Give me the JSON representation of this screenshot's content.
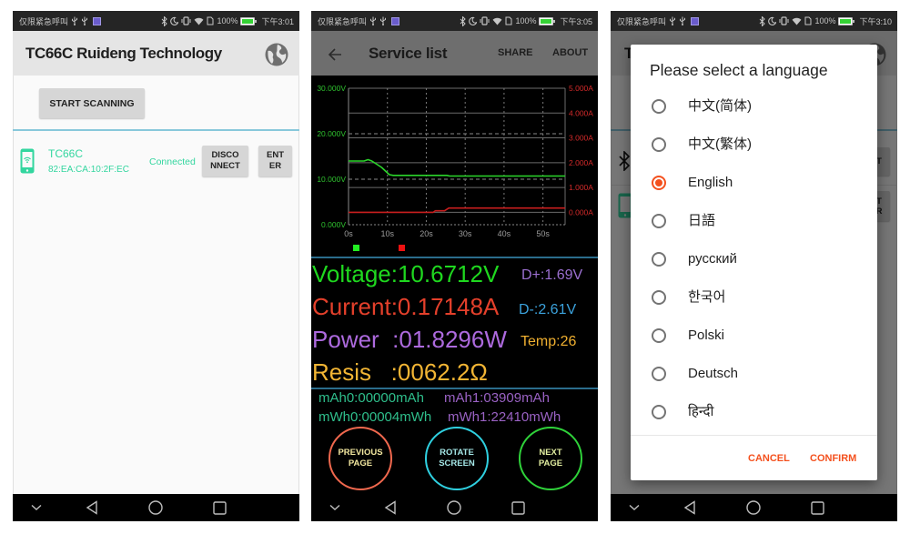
{
  "status_bar": {
    "carrier_text": "仅限紧急呼叫",
    "battery_percent": "100%",
    "icons": [
      "usb-icon",
      "usb-icon",
      "app-notification-icon",
      "bluetooth-icon",
      "moon-icon",
      "vibrate-icon",
      "wifi-icon",
      "sim-icon",
      "battery-icon"
    ]
  },
  "screens": [
    {
      "status_time": "下午3:01"
    },
    {
      "status_time": "下午3:05"
    },
    {
      "status_time": "下午3:10"
    }
  ],
  "navigation": {
    "icons": [
      "chevron-down-icon",
      "back-icon",
      "home-icon",
      "recents-icon"
    ]
  },
  "scan_screen": {
    "title": "TC66C Ruideng Technology",
    "language_icon": "globe-icon",
    "start_scanning_label": "START SCANNING",
    "device": {
      "icon": "phone-wifi-icon",
      "name": "TC66C",
      "mac": "82:EA:CA:10:2F:EC",
      "status": "Connected",
      "disconnect_label": "DISCO\nNNECT",
      "enter_label": "ENT\nER"
    }
  },
  "service_screen": {
    "title": "Service list",
    "share_label": "SHARE",
    "about_label": "ABOUT",
    "readings": {
      "voltage": "Voltage:10.6712V",
      "current": "Current:0.17148A",
      "power": "Power  :01.8296W",
      "resistance": "Resis   :0062.2Ω"
    },
    "side_readings": {
      "d_plus": "D+:1.69V",
      "d_minus": "D-:2.61V",
      "temperature": "Temp:26"
    },
    "accumulators": {
      "mah0": "mAh0:00000mAh",
      "mah1": "mAh1:03909mAh",
      "mwh0": "mWh0:00004mWh",
      "mwh1": "mWh1:22410mWh"
    },
    "buttons": {
      "previous": "PREVIOUS\nPAGE",
      "rotate": "ROTATE\nSCREEN",
      "next": "NEXT\nPAGE"
    }
  },
  "language_screen": {
    "background": {
      "title_fragment": "T",
      "button1_fragment": "T",
      "button2_fragment": "T\nR"
    },
    "dialog": {
      "title": "Please select a language",
      "options": [
        {
          "label": "中文(简体)",
          "selected": false
        },
        {
          "label": "中文(繁体)",
          "selected": false
        },
        {
          "label": "English",
          "selected": true
        },
        {
          "label": "日語",
          "selected": false
        },
        {
          "label": "русский",
          "selected": false
        },
        {
          "label": "한국어",
          "selected": false
        },
        {
          "label": "Polski",
          "selected": false
        },
        {
          "label": "Deutsch",
          "selected": false
        },
        {
          "label": "हिन्दी",
          "selected": false
        }
      ],
      "cancel_label": "CANCEL",
      "confirm_label": "CONFIRM"
    }
  },
  "colors": {
    "device_teal": "#33d69f",
    "divider_blue": "#88c8db",
    "dialog_accent": "#f4511e",
    "voltage_text": "#1fd81f",
    "current_text": "#e4402b",
    "power_text": "#ad6ade",
    "resistance_text": "#f2b534",
    "d_plus_text": "#9b6fd0",
    "d_minus_text": "#3ba2dc",
    "temperature_text": "#f0b030",
    "accum0_text": "#2fbf8c",
    "accum1_text": "#9a62c4",
    "previous_ring": "#f0684e",
    "rotate_ring": "#2fd0e0",
    "next_ring": "#2fd23a"
  },
  "chart_data": {
    "type": "line",
    "title": "",
    "grid": true,
    "x": {
      "label": "",
      "ticks": [
        "0s",
        "10s",
        "20s",
        "30s",
        "40s",
        "50s"
      ],
      "tick_values": [
        0,
        10,
        20,
        30,
        40,
        50
      ],
      "range": [
        0,
        55.7
      ]
    },
    "y_left": {
      "label": "",
      "ticks": [
        "0.000V",
        "10.000V",
        "20.000V",
        "30.000V"
      ],
      "tick_values": [
        0,
        10,
        20,
        30
      ],
      "range": [
        0,
        30
      ],
      "color": "#2fc22f"
    },
    "y_right": {
      "label": "",
      "ticks": [
        "0.000A",
        "1.000A",
        "2.000A",
        "3.000A",
        "4.000A",
        "5.000A"
      ],
      "tick_values": [
        0,
        1,
        2,
        3,
        4,
        5
      ],
      "range": [
        -0.5,
        5
      ],
      "color": "#d42a2a"
    },
    "series": [
      {
        "id": "voltage",
        "name": "Voltage",
        "axis": "left",
        "color": "#2bd62b",
        "points": [
          [
            0,
            14.0
          ],
          [
            4,
            14.0
          ],
          [
            5,
            14.3
          ],
          [
            6,
            14.0
          ],
          [
            8.5,
            12.6
          ],
          [
            10.5,
            11.0
          ],
          [
            11.5,
            10.85
          ],
          [
            25.3,
            10.85
          ],
          [
            26,
            10.7
          ],
          [
            55.7,
            10.7
          ]
        ]
      },
      {
        "id": "current",
        "name": "Current",
        "axis": "right",
        "color": "#c81e1e",
        "points": [
          [
            0,
            0.0
          ],
          [
            21.8,
            0.0
          ],
          [
            22.3,
            0.06
          ],
          [
            24.7,
            0.06
          ],
          [
            25.8,
            0.17
          ],
          [
            55.7,
            0.17
          ]
        ]
      }
    ],
    "legend": [
      {
        "series": "voltage",
        "color": "#22ee22"
      },
      {
        "series": "current",
        "color": "#ee1111"
      }
    ],
    "legend_position": "bottom-left"
  }
}
